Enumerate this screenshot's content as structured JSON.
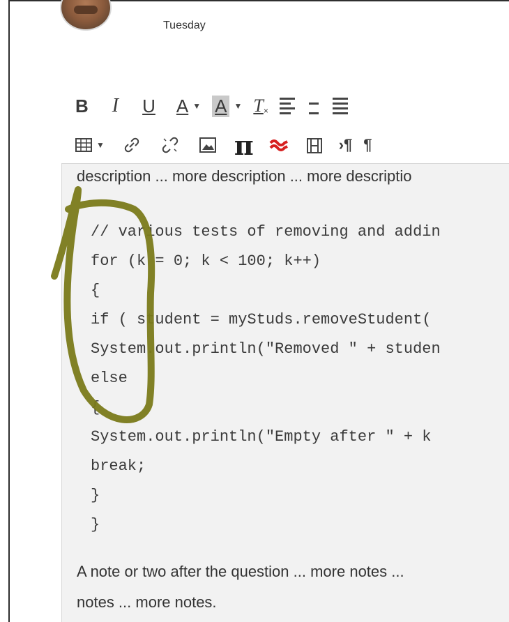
{
  "header": {
    "day": "Tuesday"
  },
  "toolbar": {
    "bold": "B",
    "italic": "I",
    "underline": "U",
    "text_color": "A",
    "bg_color": "A",
    "clear_format": "T",
    "pi_symbol": "π",
    "paragraph_symbol": "¶"
  },
  "editor": {
    "description": "description ... more description ... more descriptio",
    "code_lines": [
      "// various tests of removing and addin",
      "for (k = 0; k < 100; k++)",
      "{",
      "if ( student = myStuds.removeStudent(",
      "System.out.println(\"Removed \" + studen",
      "else",
      "{",
      "System.out.println(\"Empty after \" + k",
      "break;",
      "}",
      "}"
    ],
    "note_line1": "A note or two after the question ... more notes ...",
    "note_line2": "notes ... more notes."
  },
  "colors": {
    "annotation": "#7a7a1a",
    "editor_bg": "#f2f2f2",
    "red_icon": "#d62020"
  },
  "icons": [
    "bold-icon",
    "italic-icon",
    "underline-icon",
    "text-color-icon",
    "background-color-icon",
    "clear-format-icon",
    "align-left-icon",
    "align-center-icon",
    "table-icon",
    "link-icon",
    "unlink-icon",
    "image-icon",
    "math-icon",
    "red-wave-icon",
    "film-icon",
    "ltr-icon",
    "paragraph-icon"
  ]
}
